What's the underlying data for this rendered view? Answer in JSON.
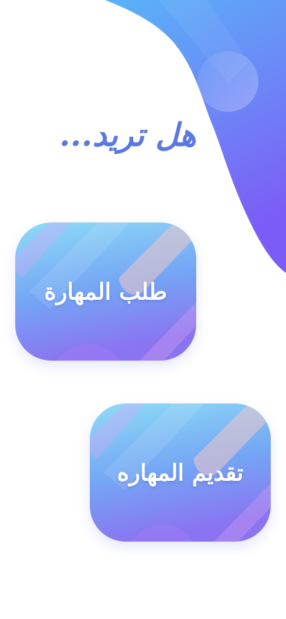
{
  "prompt": {
    "text": "هل تريد..."
  },
  "options": {
    "request_skill_label": "طلب المهارة",
    "offer_skill_label": "تقديم المهاره"
  },
  "colors": {
    "accent_text": "#5a78e2",
    "blob_light": "#59b3f8",
    "blob_dark": "#7c5cf6",
    "card_top": "#8fdcf6",
    "card_bottom": "#8a74f2"
  }
}
